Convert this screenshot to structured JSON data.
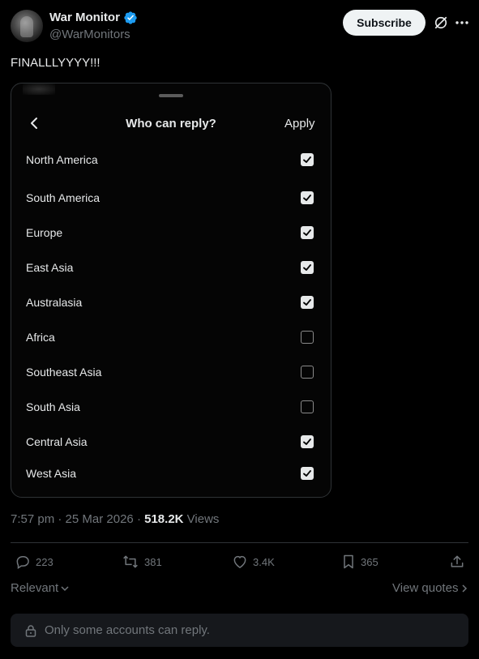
{
  "author": {
    "display_name": "War Monitor",
    "handle": "@WarMonitors",
    "verified": true,
    "verified_color": "#1d9bf0"
  },
  "header": {
    "subscribe_label": "Subscribe",
    "icons": [
      "grok-icon",
      "more-icon"
    ]
  },
  "tweet": {
    "text": "FINALLLYYYY!!!"
  },
  "sheet": {
    "title": "Who can reply?",
    "apply_label": "Apply",
    "back_icon": "chevron-left-icon",
    "regions": [
      {
        "label": "North America",
        "checked": true
      },
      {
        "label": "South America",
        "checked": true
      },
      {
        "label": "Europe",
        "checked": true
      },
      {
        "label": "East Asia",
        "checked": true
      },
      {
        "label": "Australasia",
        "checked": true
      },
      {
        "label": "Africa",
        "checked": false
      },
      {
        "label": "Southeast Asia",
        "checked": false
      },
      {
        "label": "South Asia",
        "checked": false
      },
      {
        "label": "Central Asia",
        "checked": true
      },
      {
        "label": "West Asia",
        "checked": true
      }
    ]
  },
  "meta": {
    "time": "7:57 pm",
    "date": "25 Mar 2026",
    "views_count": "518.2K",
    "views_label": "Views"
  },
  "actions": {
    "replies": "223",
    "reposts": "381",
    "likes": "3.4K",
    "bookmarks": "365"
  },
  "footer": {
    "sort_label": "Relevant",
    "view_quotes_label": "View quotes",
    "reply_notice": "Only some accounts can reply."
  }
}
